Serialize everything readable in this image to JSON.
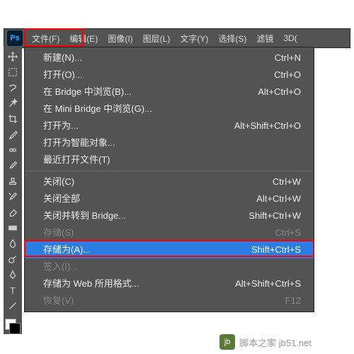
{
  "logo": "Ps",
  "menubar": [
    "文件(F)",
    "编辑(E)",
    "图像(I)",
    "图层(L)",
    "文字(Y)",
    "选择(S)",
    "滤镜",
    "3D("
  ],
  "menu": {
    "g1": [
      {
        "label": "新建(N)...",
        "shortcut": "Ctrl+N"
      },
      {
        "label": "打开(O)...",
        "shortcut": "Ctrl+O"
      },
      {
        "label": "在 Bridge 中浏览(B)...",
        "shortcut": "Alt+Ctrl+O"
      },
      {
        "label": "在 Mini Bridge 中浏览(G)...",
        "shortcut": ""
      },
      {
        "label": "打开为...",
        "shortcut": "Alt+Shift+Ctrl+O"
      },
      {
        "label": "打开为智能对象...",
        "shortcut": ""
      },
      {
        "label": "最近打开文件(T)",
        "shortcut": ""
      }
    ],
    "g2": [
      {
        "label": "关闭(C)",
        "shortcut": "Ctrl+W"
      },
      {
        "label": "关闭全部",
        "shortcut": "Alt+Ctrl+W"
      },
      {
        "label": "关闭并转到 Bridge...",
        "shortcut": "Shift+Ctrl+W"
      },
      {
        "label": "存储(S)",
        "shortcut": "Ctrl+S",
        "disabled": true
      },
      {
        "label": "存储为(A)...",
        "shortcut": "Shift+Ctrl+S",
        "selected": true
      },
      {
        "label": "签入(I)...",
        "shortcut": "",
        "disabled": true
      },
      {
        "label": "存储为 Web 所用格式...",
        "shortcut": "Alt+Shift+Ctrl+S"
      },
      {
        "label": "恢复(V)",
        "shortcut": "F12",
        "disabled": true
      }
    ]
  },
  "watermark": "脚本之家 jb51.net"
}
